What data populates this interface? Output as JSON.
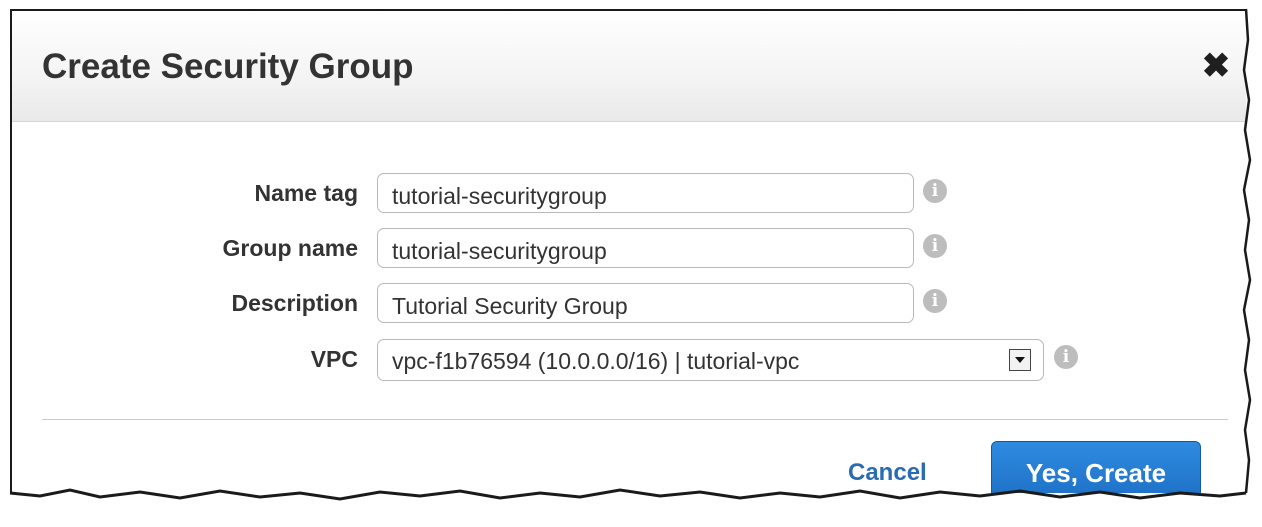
{
  "dialog": {
    "title": "Create Security Group",
    "close_icon": "close-icon"
  },
  "form": {
    "name_tag": {
      "label": "Name tag",
      "value": "tutorial-securitygroup"
    },
    "group_name": {
      "label": "Group name",
      "value": "tutorial-securitygroup"
    },
    "description": {
      "label": "Description",
      "value": "Tutorial Security Group"
    },
    "vpc": {
      "label": "VPC",
      "selected": "vpc-f1b76594 (10.0.0.0/16) | tutorial-vpc"
    },
    "info_icon_glyph": "i"
  },
  "footer": {
    "cancel_label": "Cancel",
    "create_label": "Yes, Create"
  },
  "colors": {
    "primary_button": "#1c6fc4",
    "link": "#2b6bb3",
    "title_text": "#333333"
  }
}
